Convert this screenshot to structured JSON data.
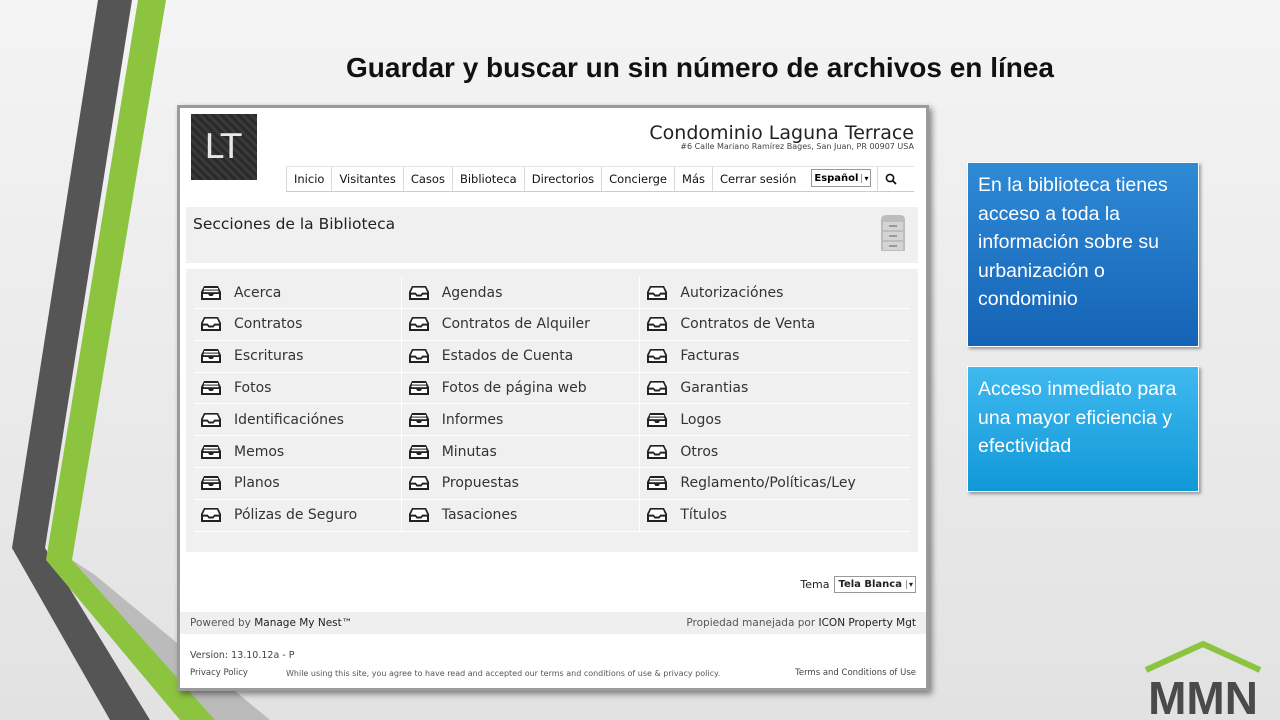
{
  "slide": {
    "title": "Guardar y buscar un sin número de archivos en línea",
    "colors": {
      "accent_green": "#8cc43f",
      "callout_dark": "#1563b6",
      "callout_light": "#1198d8"
    }
  },
  "app": {
    "logo_text": "LT",
    "site_name": "Condominio Laguna Terrace",
    "site_address": "#6 Calle Mariano Ramírez Bages, San Juan, PR  00907  USA",
    "nav": [
      "Inicio",
      "Visitantes",
      "Casos",
      "Biblioteca",
      "Directorios",
      "Concierge",
      "Más",
      "Cerrar sesión"
    ],
    "language": "Español",
    "search_icon": "search-icon",
    "section_title": "Secciones de la Biblioteca",
    "cabinet_icon": "filing-cabinet-icon",
    "library_rows": [
      [
        {
          "label": "Acerca",
          "icon": "tray-full-icon"
        },
        {
          "label": "Agendas",
          "icon": "tray-empty-icon"
        },
        {
          "label": "Autorizaciónes",
          "icon": "tray-empty-icon"
        }
      ],
      [
        {
          "label": "Contratos",
          "icon": "tray-empty-icon"
        },
        {
          "label": "Contratos de Alquiler",
          "icon": "tray-empty-icon"
        },
        {
          "label": "Contratos de Venta",
          "icon": "tray-empty-icon"
        }
      ],
      [
        {
          "label": "Escrituras",
          "icon": "tray-full-icon"
        },
        {
          "label": "Estados de Cuenta",
          "icon": "tray-empty-icon"
        },
        {
          "label": "Facturas",
          "icon": "tray-empty-icon"
        }
      ],
      [
        {
          "label": "Fotos",
          "icon": "tray-full-icon"
        },
        {
          "label": "Fotos de página web",
          "icon": "tray-full-icon"
        },
        {
          "label": "Garantias",
          "icon": "tray-empty-icon"
        }
      ],
      [
        {
          "label": "Identificaciónes",
          "icon": "tray-empty-icon"
        },
        {
          "label": "Informes",
          "icon": "tray-full-icon"
        },
        {
          "label": "Logos",
          "icon": "tray-full-icon"
        }
      ],
      [
        {
          "label": "Memos",
          "icon": "tray-full-icon"
        },
        {
          "label": "Minutas",
          "icon": "tray-full-icon"
        },
        {
          "label": "Otros",
          "icon": "tray-empty-icon"
        }
      ],
      [
        {
          "label": "Planos",
          "icon": "tray-full-icon"
        },
        {
          "label": "Propuestas",
          "icon": "tray-empty-icon"
        },
        {
          "label": "Reglamento/Políticas/Ley",
          "icon": "tray-full-icon"
        }
      ],
      [
        {
          "label": "Pólizas de Seguro",
          "icon": "tray-empty-icon"
        },
        {
          "label": "Tasaciones",
          "icon": "tray-empty-icon"
        },
        {
          "label": "Títulos",
          "icon": "tray-empty-icon"
        }
      ]
    ],
    "theme_label": "Tema",
    "theme_value": "Tela Blanca",
    "powered_prefix": "Powered by",
    "powered_name": "Manage My Nest™",
    "managed_prefix": "Propiedad manejada por",
    "managed_name": "ICON Property Mgt",
    "version": "Version: 13.10.12a - P",
    "privacy": "Privacy Policy",
    "terms_note": "While using this site, you agree to have read and accepted our terms and conditions of use & privacy policy.",
    "terms_link": "Terms and Conditions of Use"
  },
  "callouts": [
    "En la biblioteca tienes acceso a toda la información sobre su urbanización o condominio",
    "Acceso inmediato para una mayor eficiencia y efectividad"
  ],
  "brand_logo_text": "MMN"
}
